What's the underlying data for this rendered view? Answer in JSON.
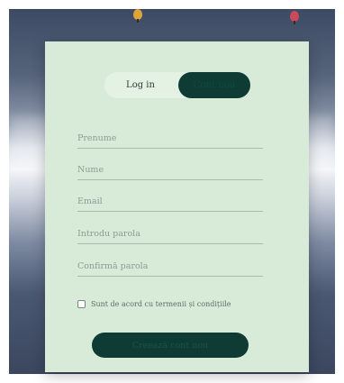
{
  "auth": {
    "tabs": {
      "login": "Log in",
      "register": "Cont nou"
    },
    "fields": [
      {
        "name": "first-name-input",
        "placeholder": "Prenume"
      },
      {
        "name": "last-name-input",
        "placeholder": "Nume"
      },
      {
        "name": "email-input",
        "placeholder": "Email"
      },
      {
        "name": "password-input",
        "placeholder": "Introdu parola"
      },
      {
        "name": "confirm-password-input",
        "placeholder": "Confirmă parola"
      }
    ],
    "terms_label": "Sunt de acord cu termenii și condițiile",
    "submit_label": "Creează cont nou"
  },
  "colors": {
    "card_bg": "#d8ebd8",
    "accent": "#0e3b33"
  }
}
